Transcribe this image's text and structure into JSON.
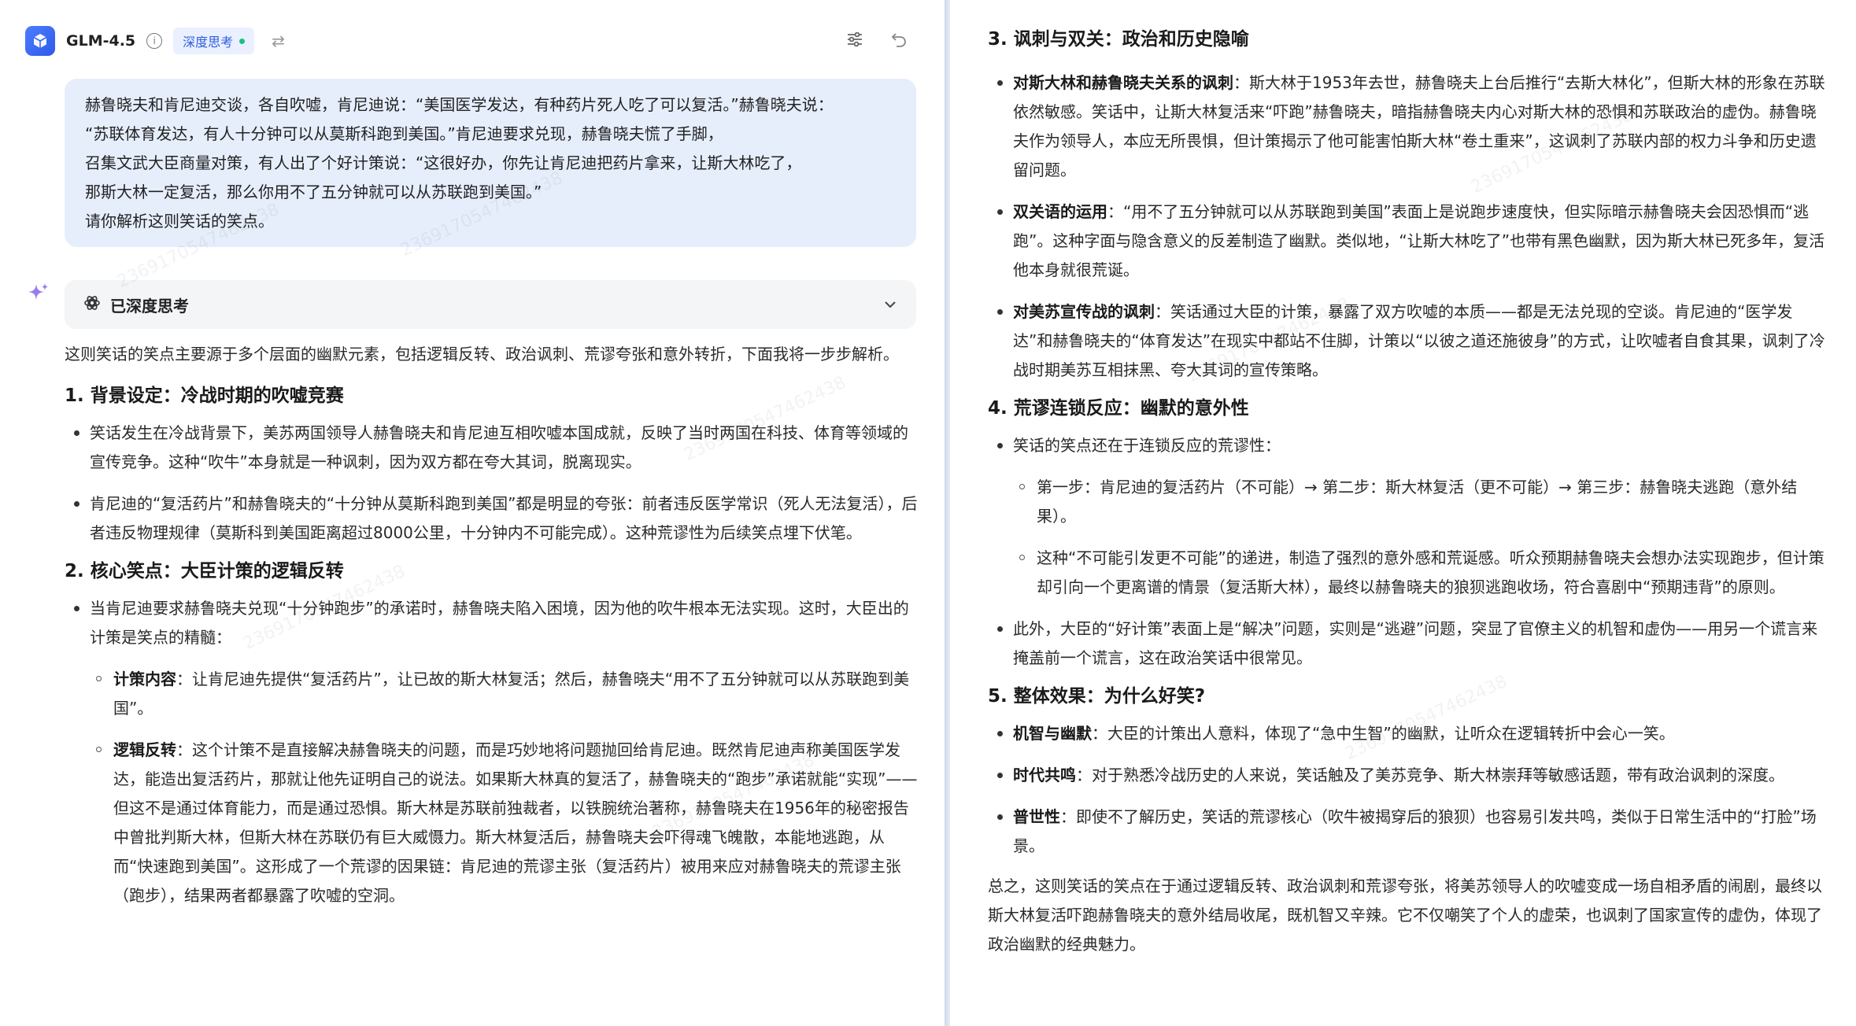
{
  "header": {
    "model": "GLM-4.5",
    "mode_badge": "深度思考"
  },
  "user_message": {
    "lines": [
      "赫鲁晓夫和肯尼迪交谈，各自吹嘘，肯尼迪说：“美国医学发达，有种药片死人吃了可以复活。”赫鲁晓夫说：",
      "“苏联体育发达，有人十分钟可以从莫斯科跑到美国。”肯尼迪要求兑现，赫鲁晓夫慌了手脚，",
      "召集文武大臣商量对策，有人出了个好计策说：“这很好办，你先让肯尼迪把药片拿来，让斯大林吃了，",
      "那斯大林一定复活，那么你用不了五分钟就可以从苏联跑到美国。”",
      "请你解析这则笑话的笑点。"
    ]
  },
  "thinking": {
    "label": "已深度思考"
  },
  "watermark": "2369170547462438",
  "left": {
    "intro": "这则笑话的笑点主要源于多个层面的幽默元素，包括逻辑反转、政治讽刺、荒谬夸张和意外转折，下面我将一步步解析。",
    "s1": {
      "title": "1. 背景设定：冷战时期的吹嘘竞赛",
      "b1": "笑话发生在冷战背景下，美苏两国领导人赫鲁晓夫和肯尼迪互相吹嘘本国成就，反映了当时两国在科技、体育等领域的宣传竞争。这种“吹牛”本身就是一种讽刺，因为双方都在夸大其词，脱离现实。",
      "b2": "肯尼迪的“复活药片”和赫鲁晓夫的“十分钟从莫斯科跑到美国”都是明显的夸张：前者违反医学常识（死人无法复活），后者违反物理规律（莫斯科到美国距离超过8000公里，十分钟内不可能完成）。这种荒谬性为后续笑点埋下伏笔。"
    },
    "s2": {
      "title": "2. 核心笑点：大臣计策的逻辑反转",
      "b1": "当肯尼迪要求赫鲁晓夫兑现“十分钟跑步”的承诺时，赫鲁晓夫陷入困境，因为他的吹牛根本无法实现。这时，大臣出的计策是笑点的精髓：",
      "c1_label": "计策内容",
      "c1_text": "：让肯尼迪先提供“复活药片”，让已故的斯大林复活；然后，赫鲁晓夫“用不了五分钟就可以从苏联跑到美国”。",
      "c2_label": "逻辑反转",
      "c2_text": "：这个计策不是直接解决赫鲁晓夫的问题，而是巧妙地将问题抛回给肯尼迪。既然肯尼迪声称美国医学发达，能造出复活药片，那就让他先证明自己的说法。如果斯大林真的复活了，赫鲁晓夫的“跑步”承诺就能“实现”——但这不是通过体育能力，而是通过恐惧。斯大林是苏联前独裁者，以铁腕统治著称，赫鲁晓夫在1956年的秘密报告中曾批判斯大林，但斯大林在苏联仍有巨大威慑力。斯大林复活后，赫鲁晓夫会吓得魂飞魄散，本能地逃跑，从而“快速跑到美国”。这形成了一个荒谬的因果链：肯尼迪的荒谬主张（复活药片）被用来应对赫鲁晓夫的荒谬主张（跑步），结果两者都暴露了吹嘘的空洞。"
    }
  },
  "right": {
    "s3": {
      "title": "3. 讽刺与双关：政治和历史隐喻",
      "b1_label": "对斯大林和赫鲁晓夫关系的讽刺",
      "b1_text": "：斯大林于1953年去世，赫鲁晓夫上台后推行“去斯大林化”，但斯大林的形象在苏联依然敏感。笑话中，让斯大林复活来“吓跑”赫鲁晓夫，暗指赫鲁晓夫内心对斯大林的恐惧和苏联政治的虚伪。赫鲁晓夫作为领导人，本应无所畏惧，但计策揭示了他可能害怕斯大林“卷土重来”，这讽刺了苏联内部的权力斗争和历史遗留问题。",
      "b2_label": "双关语的运用",
      "b2_text": "：“用不了五分钟就可以从苏联跑到美国”表面上是说跑步速度快，但实际暗示赫鲁晓夫会因恐惧而“逃跑”。这种字面与隐含意义的反差制造了幽默。类似地，“让斯大林吃了”也带有黑色幽默，因为斯大林已死多年，复活他本身就很荒诞。",
      "b3_label": "对美苏宣传战的讽刺",
      "b3_text": "：笑话通过大臣的计策，暴露了双方吹嘘的本质——都是无法兑现的空谈。肯尼迪的“医学发达”和赫鲁晓夫的“体育发达”在现实中都站不住脚，计策以“以彼之道还施彼身”的方式，让吹嘘者自食其果，讽刺了冷战时期美苏互相抹黑、夸大其词的宣传策略。"
    },
    "s4": {
      "title": "4. 荒谬连锁反应：幽默的意外性",
      "b1": "笑话的笑点还在于连锁反应的荒谬性：",
      "c1": "第一步：肯尼迪的复活药片（不可能）→ 第二步：斯大林复活（更不可能）→ 第三步：赫鲁晓夫逃跑（意外结果）。",
      "c2": "这种“不可能引发更不可能”的递进，制造了强烈的意外感和荒诞感。听众预期赫鲁晓夫会想办法实现跑步，但计策却引向一个更离谱的情景（复活斯大林），最终以赫鲁晓夫的狼狈逃跑收场，符合喜剧中“预期违背”的原则。",
      "b2": "此外，大臣的“好计策”表面上是“解决”问题，实则是“逃避”问题，突显了官僚主义的机智和虚伪——用另一个谎言来掩盖前一个谎言，这在政治笑话中很常见。"
    },
    "s5": {
      "title": "5. 整体效果：为什么好笑?",
      "b1_label": "机智与幽默",
      "b1_text": "：大臣的计策出人意料，体现了“急中生智”的幽默，让听众在逻辑转折中会心一笑。",
      "b2_label": "时代共鸣",
      "b2_text": "：对于熟悉冷战历史的人来说，笑话触及了美苏竞争、斯大林崇拜等敏感话题，带有政治讽刺的深度。",
      "b3_label": "普世性",
      "b3_text": "：即使不了解历史，笑话的荒谬核心（吹牛被揭穿后的狼狈）也容易引发共鸣，类似于日常生活中的“打脸”场景。"
    },
    "summary": "总之，这则笑话的笑点在于通过逻辑反转、政治讽刺和荒谬夸张，将美苏领导人的吹嘘变成一场自相矛盾的闹剧，最终以斯大林复活吓跑赫鲁晓夫的意外结局收尾，既机智又辛辣。它不仅嘲笑了个人的虚荣，也讽刺了国家宣传的虚伪，体现了政治幽默的经典魅力。"
  }
}
